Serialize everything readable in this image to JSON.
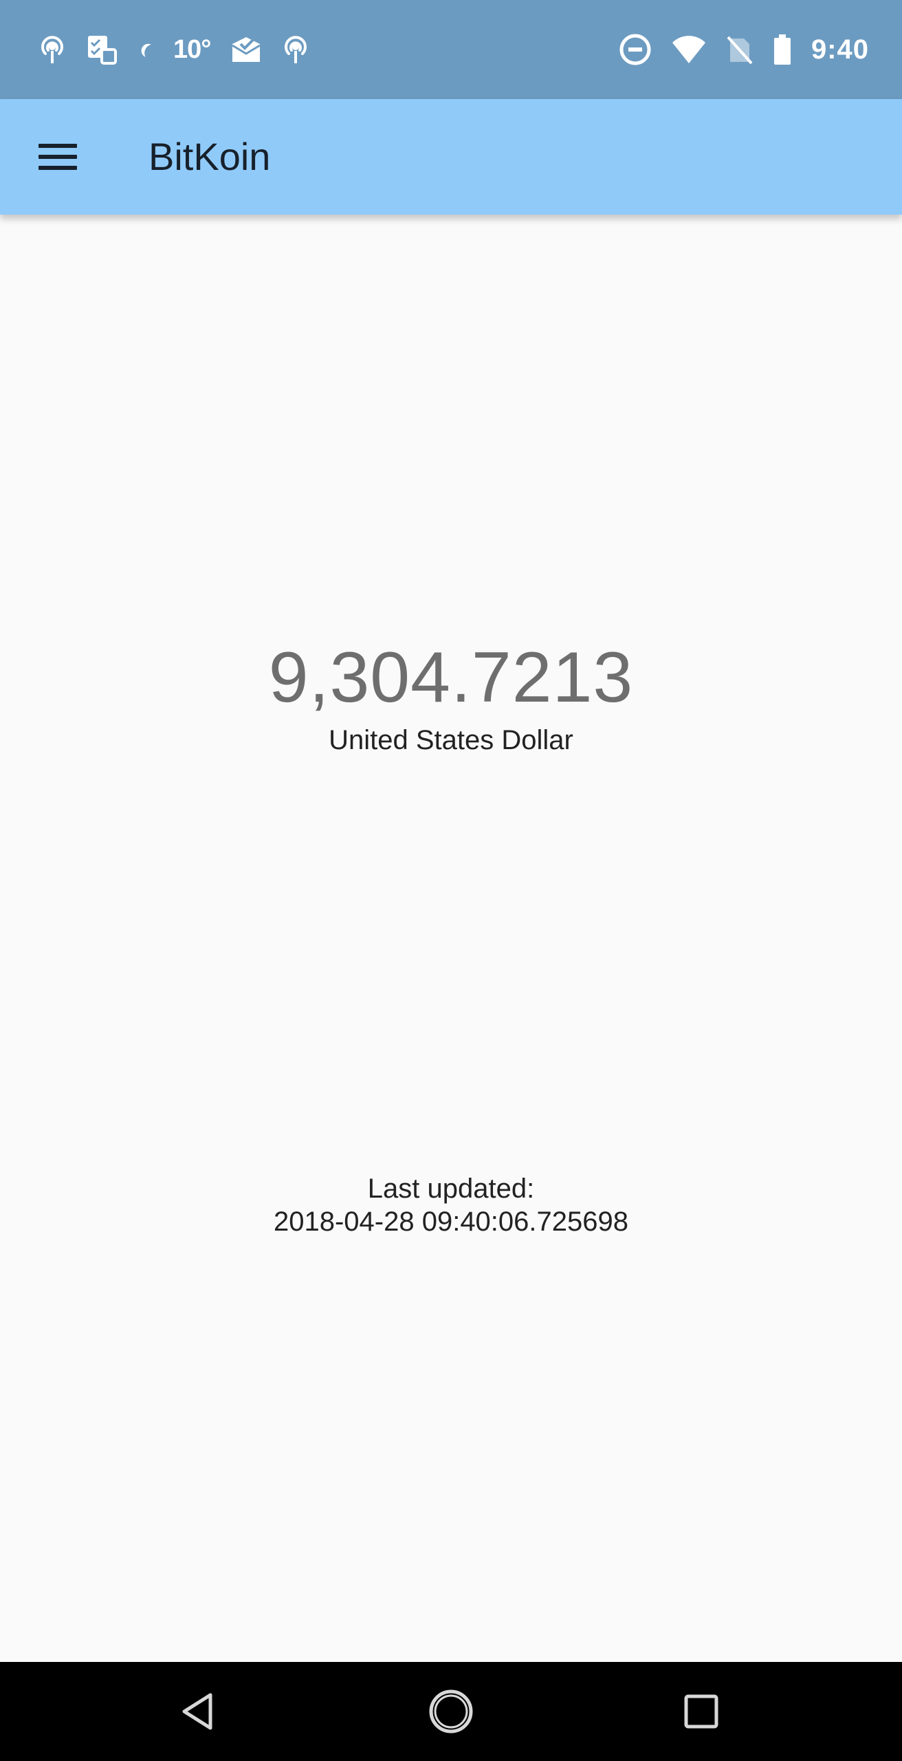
{
  "status_bar": {
    "left_icons": [
      "podcast-icon",
      "tasks-icon",
      "moon-icon"
    ],
    "temperature": "10°",
    "more_left_icons": [
      "inbox-check-icon",
      "podcast-icon"
    ],
    "right_icons": [
      "do-not-disturb-icon",
      "wifi-icon",
      "no-sim-icon",
      "battery-icon"
    ],
    "time": "9:40",
    "background_color": "#6c9bc1"
  },
  "app_bar": {
    "menu_icon": "hamburger-menu-icon",
    "title": "BitKoin",
    "background_color": "#90caf9"
  },
  "price": {
    "value": "9,304.7213",
    "currency": "United States Dollar"
  },
  "update_info": {
    "label": "Last updated:",
    "timestamp": "2018-04-28 09:40:06.725698"
  },
  "nav_bar": {
    "buttons": [
      "back-icon",
      "home-icon",
      "recents-icon"
    ]
  }
}
